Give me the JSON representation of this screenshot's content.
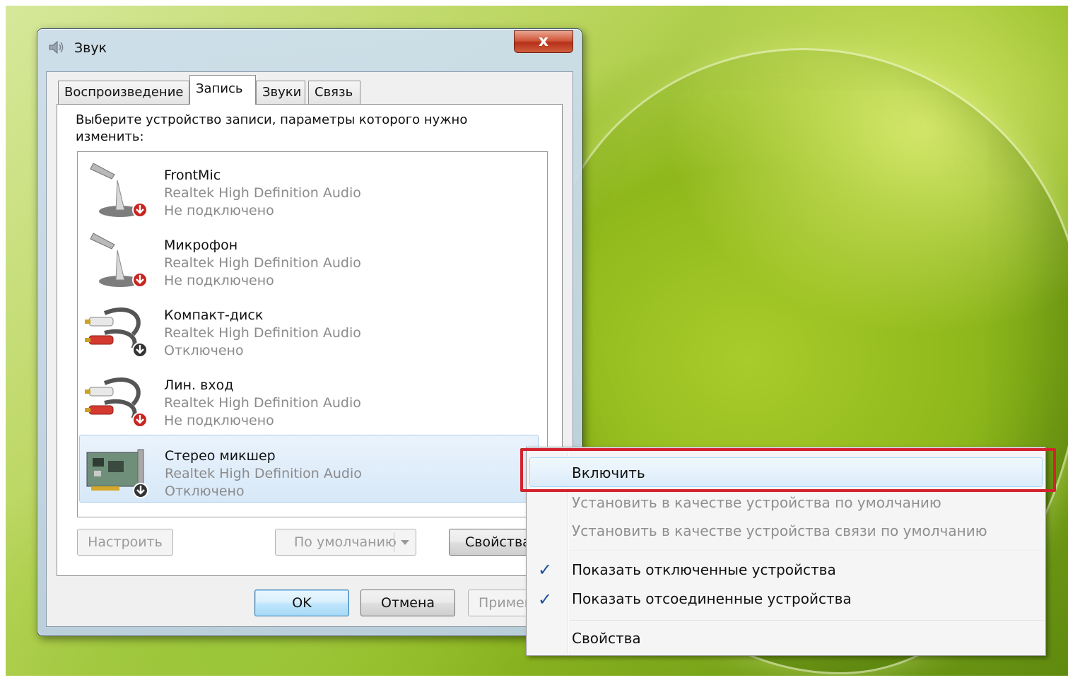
{
  "window": {
    "title": "Звук",
    "close_label": "x"
  },
  "tabs": [
    {
      "label": "Воспроизведение"
    },
    {
      "label": "Запись"
    },
    {
      "label": "Звуки"
    },
    {
      "label": "Связь"
    }
  ],
  "instruction": "Выберите устройство записи, параметры которого нужно изменить:",
  "devices": [
    {
      "name": "FrontMic",
      "driver": "Realtek High Definition Audio",
      "status": "Не подключено",
      "icon": "microphone-icon"
    },
    {
      "name": "Микрофон",
      "driver": "Realtek High Definition Audio",
      "status": "Не подключено",
      "icon": "microphone-icon"
    },
    {
      "name": "Компакт-диск",
      "driver": "Realtek High Definition Audio",
      "status": "Отключено",
      "icon": "rca-cable-icon"
    },
    {
      "name": "Лин. вход",
      "driver": "Realtek High Definition Audio",
      "status": "Не подключено",
      "icon": "rca-cable-icon"
    },
    {
      "name": "Стерео микшер",
      "driver": "Realtek High Definition Audio",
      "status": "Отключено",
      "icon": "sound-card-icon"
    }
  ],
  "buttons": {
    "configure": "Настроить",
    "default": "По умолчанию",
    "properties": "Свойства",
    "ok": "OK",
    "cancel": "Отмена",
    "apply": "Применить"
  },
  "context_menu": {
    "enable": "Включить",
    "set_default": "Установить в качестве устройства по умолчанию",
    "set_comm_default": "Установить в качестве устройства связи по умолчанию",
    "show_disabled": "Показать отключенные устройства",
    "show_disconnected": "Показать отсоединенные устройства",
    "properties": "Свойства",
    "check_mark": "✓"
  },
  "colors": {
    "highlight_border": "#d3232e",
    "selection_bg": "#d7e8f8",
    "disabled_text": "#8b8b8b"
  }
}
